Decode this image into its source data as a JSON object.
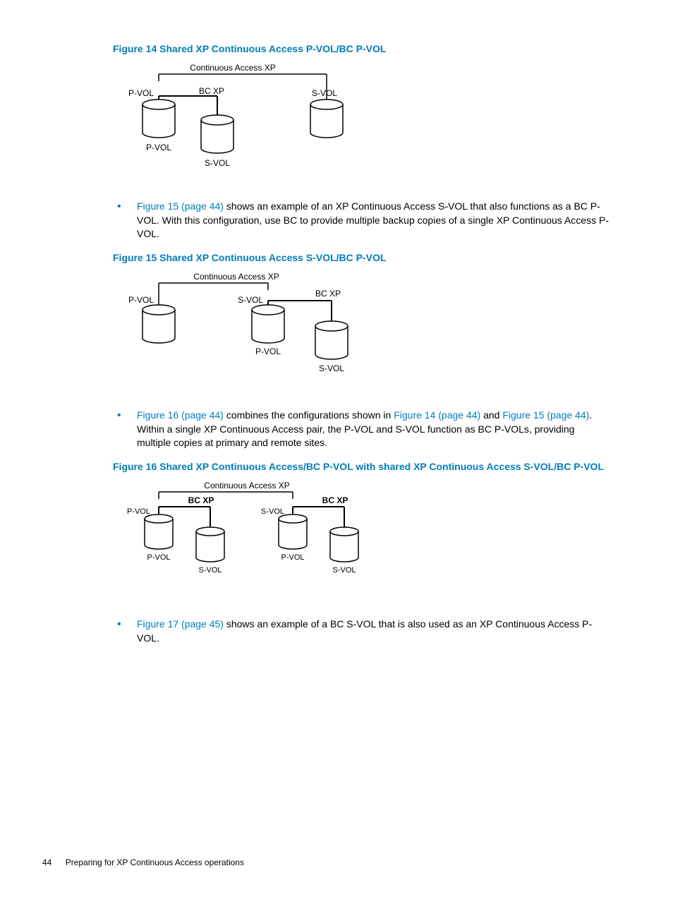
{
  "figure14": {
    "title": "Figure 14 Shared XP Continuous Access P-VOL/BC P-VOL",
    "diagram": {
      "header": "Continuous Access XP",
      "bc_label": "BC XP",
      "left_top": "P-VOL",
      "left_bottom": "P-VOL",
      "mid_bottom": "S-VOL",
      "right_top": "S-VOL"
    }
  },
  "bullet1": {
    "link": "Figure 15 (page 44)",
    "text": " shows an example of an XP Continuous Access S-VOL that also functions as a BC P-VOL. With this configuration, use BC to provide multiple backup copies of a single XP Continuous Access P-VOL."
  },
  "figure15": {
    "title": "Figure 15 Shared XP Continuous Access S-VOL/BC P-VOL",
    "diagram": {
      "header": "Continuous Access XP",
      "bc_label": "BC XP",
      "left_top": "P-VOL",
      "mid_top": "S-VOL",
      "mid_bottom": "P-VOL",
      "right_bottom": "S-VOL"
    }
  },
  "bullet2": {
    "link1": "Figure 16 (page 44)",
    "mid1": " combines the configurations shown in ",
    "link2": "Figure 14 (page 44)",
    "mid2": " and ",
    "link3": "Figure 15 (page 44)",
    "text": ". Within a single XP Continuous Access pair, the P-VOL and S-VOL function as BC P-VOLs, providing multiple copies at primary and remote sites."
  },
  "figure16": {
    "title": "Figure 16 Shared XP Continuous Access/BC P-VOL with shared XP Continuous Access S-VOL/BC P-VOL",
    "diagram": {
      "header": "Continuous Access XP",
      "bc_label": "BC XP",
      "l_top": "P-VOL",
      "l_bottom": "P-VOL",
      "lm_bottom": "S-VOL",
      "r_top": "S-VOL",
      "r_bottom": "P-VOL",
      "rm_bottom": "S-VOL"
    }
  },
  "bullet3": {
    "link": "Figure 17 (page 45)",
    "text": " shows an example of a BC S-VOL that is also used as an XP Continuous Access P-VOL."
  },
  "footer": {
    "page": "44",
    "title": "Preparing for XP Continuous Access operations"
  }
}
